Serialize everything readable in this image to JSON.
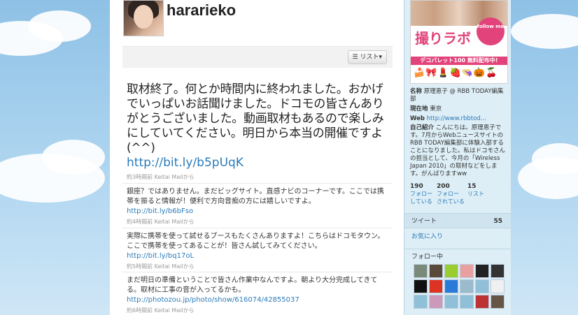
{
  "profile": {
    "username": "hararieko"
  },
  "toolbar": {
    "list_label": "リスト▾"
  },
  "timeline": [
    {
      "text": "取材終了。何とか時間内に終われました。おかげでいっぱいお話聞けました。ドコモの皆さんありがとうございました。動画取材もあるので楽しみにしていてください。明日から本当の開催ですよ(^^)",
      "link": "http://bit.ly/b5pUqK",
      "meta": "約3時間前 Keitai Mailから"
    },
    {
      "text": "銀座？ではありません。まだビッグサイト。直感ナビのコーナーです。ここでは携帯を振ると情報が！便利で方向音痴の方には嬉しいですよ。",
      "link": "http://bit.ly/b6bFso",
      "meta": "約4時間前 Keitai Mailから"
    },
    {
      "text": "実際に携帯を使って試せるブースもたくさんありますよ！こちらはドコモタウン。ここで携帯を使ってあることが！皆さん試してみてください。",
      "link": "http://bit.ly/bq17oL",
      "meta": "約5時間前 Keitai Mailから"
    },
    {
      "text": "まだ明日の準備ということで皆さん作業中なんですよ。朝より大分完成してきてる。取材に工事の音が入ってるかも。",
      "link": "http://photozou.jp/photo/show/616074/42855037",
      "meta": "約6時間前 Keitai Mailから"
    }
  ],
  "sidebar": {
    "banner": {
      "logo": "撮りラボ",
      "follow": "follow me",
      "tagline": "デコパレット100 無料配布中!"
    },
    "name_label": "名称",
    "name_value": "原理恵子 @ RBB TODAY編集部",
    "location_label": "現在地",
    "location_value": "東京",
    "web_label": "Web",
    "web_value": "http://www.rbbtod...",
    "bio_label": "自己紹介",
    "bio_value": "こんにちは。原理恵子です。7月からWebニュースサイトのRBB TODAY編集部に体験入部することになりました。私はドコモさんの担当として、今月の「Wireless Japan 2010」の取材などをします。がんばりますww",
    "stats": [
      {
        "count": "190",
        "label1": "フォロー",
        "label2": "している"
      },
      {
        "count": "200",
        "label1": "フォロー",
        "label2": "されている"
      },
      {
        "count": "15",
        "label1": "リスト",
        "label2": ""
      }
    ],
    "tweets_label": "ツイート",
    "tweets_count": "55",
    "favorites_label": "お気に入り",
    "following_label": "フォロー中"
  }
}
